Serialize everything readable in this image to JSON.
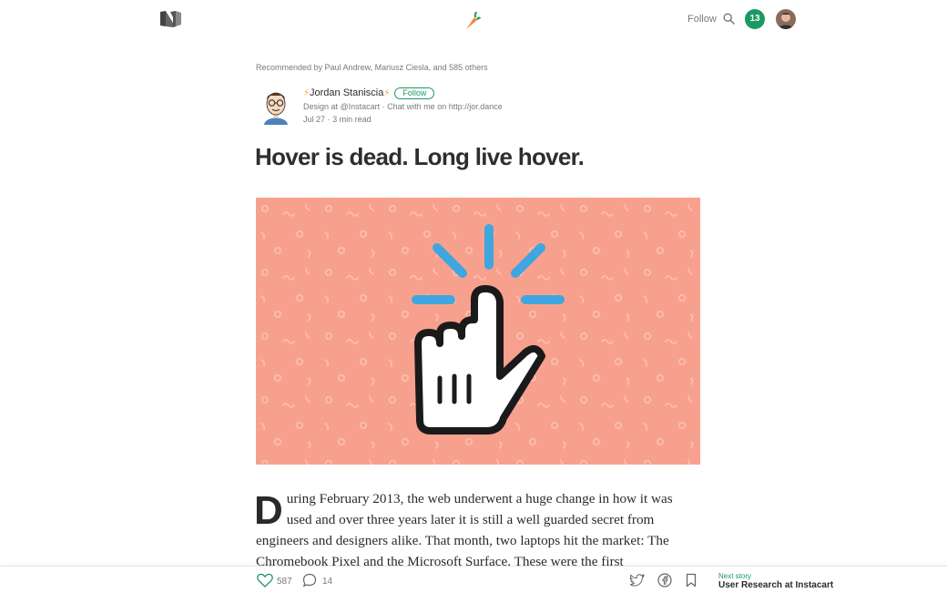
{
  "header": {
    "follow_label": "Follow",
    "notification_count": "13",
    "accent_color": "#1c9963",
    "icons": [
      "medium-logo-icon",
      "carrot-icon",
      "search-icon",
      "avatar"
    ]
  },
  "article": {
    "recommended_by": "Recommended by Paul Andrew, Mariusz Ciesla, and 585 others",
    "author": {
      "bolt": "⚡",
      "name": "Jordan Staniscia",
      "follow_label": "Follow",
      "bio": "Design at @Instacart · Chat with me on http://jor.dance",
      "date": "Jul 27",
      "separator": "·",
      "read_time": "3 min read"
    },
    "title": "Hover is dead. Long live hover.",
    "hero_colors": {
      "background": "#f8a08e",
      "rays": "#3fa6e0"
    },
    "dropcap": "D",
    "body": "uring February 2013, the web underwent a huge change in how it was used and over three years later it is still a well guarded secret from engineers and designers alike. That month, two laptops hit the market: The Chromebook Pixel and the Microsoft Surface. These were the first"
  },
  "footer": {
    "likes": "587",
    "comments": "14",
    "next_story_label": "Next story",
    "next_story_title": "User Research at Instacart",
    "icons": [
      "heart-icon",
      "comment-icon",
      "twitter-icon",
      "facebook-icon",
      "bookmark-icon"
    ]
  }
}
